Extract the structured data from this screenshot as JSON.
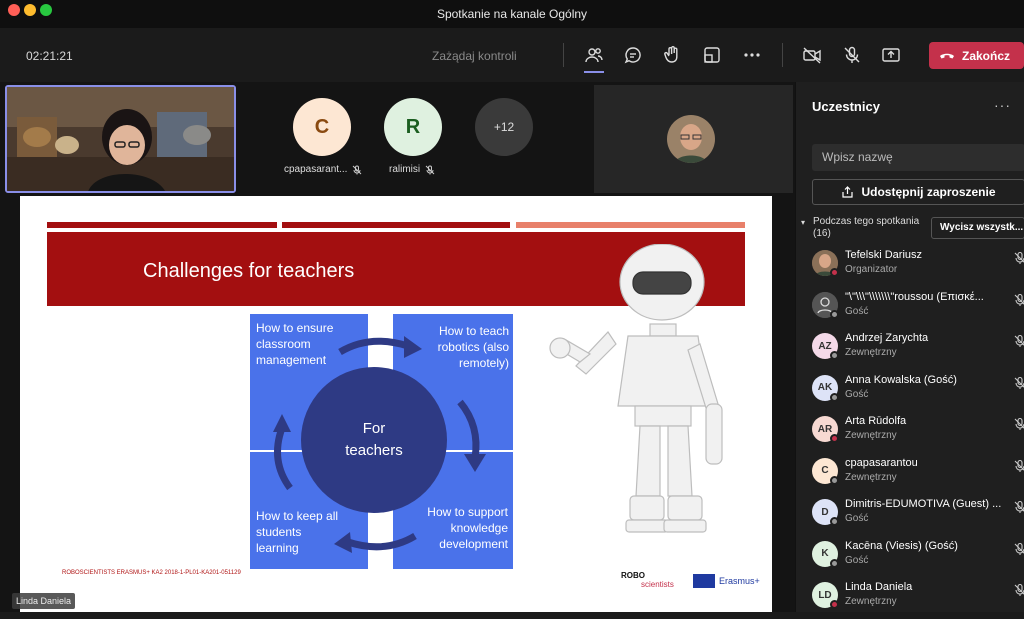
{
  "window": {
    "title": "Spotkanie na kanale Ogólny"
  },
  "toolbar": {
    "timer": "02:21:21",
    "request_control": "Zażądaj kontroli",
    "end_label": "Zakończ",
    "icons": [
      "participants-icon",
      "chat-icon",
      "reactions-icon",
      "rooms-icon",
      "more-icon",
      "camera-off-icon",
      "mic-off-icon",
      "share-icon"
    ]
  },
  "stage": {
    "self_name": "Linda Daniela",
    "tiles": [
      {
        "initial": "C",
        "name": "cpapasarant...",
        "color": "#fde7d3",
        "text_color": "#8a4a10"
      },
      {
        "initial": "R",
        "name": "ralimisi",
        "color": "#dff1e0",
        "text_color": "#1b5e20"
      }
    ],
    "overflow": "+12"
  },
  "slide": {
    "title": "Challenges for teachers",
    "center_line1": "For",
    "center_line2": "teachers",
    "q1": "How to ensure classroom management",
    "q2": "How to teach robotics (also remotely)",
    "q3": "How to keep all students learning",
    "q4": "How to support knowledge development",
    "footer": "ROBOSCIENTISTS ERASMUS+ KA2 2018-1-PL01-KA201-051129",
    "logo_robo": "ROBO",
    "logo_scientists": "scientists",
    "logo_erasmus": "Erasmus+"
  },
  "panel": {
    "title": "Uczestnicy",
    "search_placeholder": "Wpisz nazwę",
    "invite_label": "Udostępnij zaproszenie",
    "section_label": "Podczas tego spotkania",
    "section_count": "(16)",
    "mute_all": "Wycisz wszystk...",
    "participants": [
      {
        "initials": "",
        "name": "Tefelski Dariusz",
        "role": "Organizator",
        "av_color": "#6a5a4a",
        "dot": "#c4314b"
      },
      {
        "initials": "",
        "name": "\"\\\"\\\\\\\"\\\\\\\\\\\\\\\"roussou (Επισκέ...",
        "role": "Gość",
        "av_color": "#555",
        "dot": "#999"
      },
      {
        "initials": "AZ",
        "name": "Andrzej Zarychta",
        "role": "Zewnętrzny",
        "av_color": "#f4d9e8",
        "dot": "#999"
      },
      {
        "initials": "AK",
        "name": "Anna Kowalska (Gość)",
        "role": "Gość",
        "av_color": "#dde3f7",
        "dot": "#999"
      },
      {
        "initials": "AR",
        "name": "Arta Rūdolfa",
        "role": "Zewnętrzny",
        "av_color": "#f7d9d2",
        "dot": "#c4314b"
      },
      {
        "initials": "C",
        "name": "cpapasarantou",
        "role": "Zewnętrzny",
        "av_color": "#fde7d3",
        "dot": "#999"
      },
      {
        "initials": "D",
        "name": "Dimitris-EDUMOTIVA (Guest) ...",
        "role": "Gość",
        "av_color": "#dde3f7",
        "dot": "#999"
      },
      {
        "initials": "K",
        "name": "Kacēna (Viesis) (Gość)",
        "role": "Gość",
        "av_color": "#dff1e0",
        "dot": "#999"
      },
      {
        "initials": "LD",
        "name": "Linda Daniela",
        "role": "Zewnętrzny",
        "av_color": "#dff1e0",
        "dot": "#c4314b"
      }
    ]
  }
}
